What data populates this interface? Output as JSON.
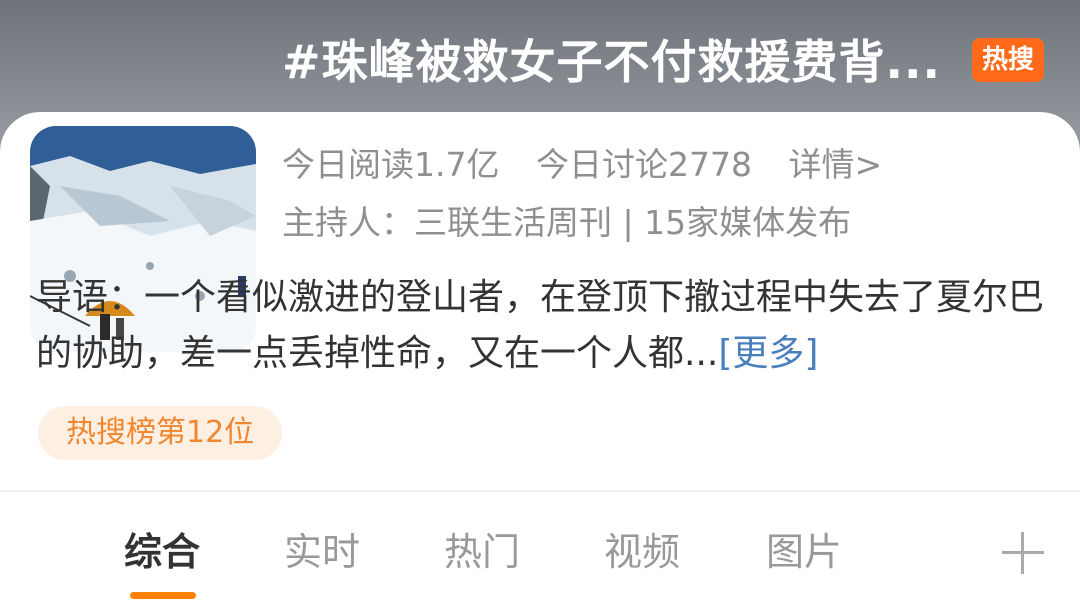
{
  "topic": {
    "title": "#珠峰被救女子不付救援费背...",
    "badge": "热搜",
    "stats": {
      "read": "今日阅读1.7亿",
      "discuss": "今日讨论2778",
      "detail": "详情>"
    },
    "host": "主持人：三联生活周刊 | 15家媒体发布",
    "intro_text": "导语：一个看似激进的登山者，在登顶下撤过程中失去了夏尔巴的协助，差一点丢掉性命，又在一个人都...",
    "intro_more": "[更多]",
    "rank_label": "热搜榜第12位",
    "thumbnail_icon": "mountain-photo"
  },
  "tabs": {
    "items": [
      {
        "label": "综合",
        "active": true
      },
      {
        "label": "实时",
        "active": false
      },
      {
        "label": "热门",
        "active": false
      },
      {
        "label": "视频",
        "active": false
      },
      {
        "label": "图片",
        "active": false
      }
    ],
    "add_icon": "plus-icon"
  },
  "colors": {
    "accent": "#ff8200",
    "badge": "#ff6a1a",
    "link": "#4a7fbd",
    "muted": "#8f8f8f",
    "text": "#333333"
  }
}
